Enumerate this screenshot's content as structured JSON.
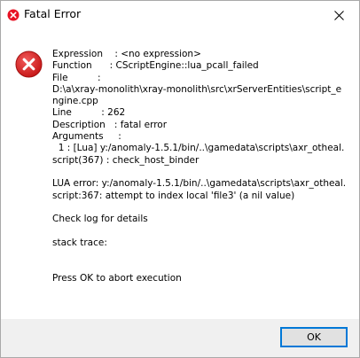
{
  "window": {
    "title": "Fatal Error",
    "app_icon": "error-app-icon",
    "close_icon": "close-icon"
  },
  "dialog": {
    "icon": "error-icon",
    "message_lines": [
      "Expression    : <no expression>",
      "Function      : CScriptEngine::lua_pcall_failed",
      "File          :",
      "D:\\a\\xray-monolith\\xray-monolith\\src\\xrServerEntities\\script_engine.cpp",
      "Line          : 262",
      "Description   : fatal error",
      "Arguments     :",
      "  1 : [Lua] y:/anomaly-1.5.1/bin/..\\gamedata\\scripts\\axr_otheal.script(367) : check_host_binder",
      "",
      "LUA error: y:/anomaly-1.5.1/bin/..\\gamedata\\scripts\\axr_otheal.script:367: attempt to index local 'file3' (a nil value)",
      "",
      "Check log for details",
      "",
      "stack trace:",
      "",
      "",
      "Press OK to abort execution"
    ]
  },
  "buttons": {
    "ok_label": "OK"
  },
  "colors": {
    "error_red": "#e81123",
    "footer_bg": "#f0f0f0",
    "button_bg": "#e1e1e1",
    "focus_blue": "#0078d7"
  }
}
